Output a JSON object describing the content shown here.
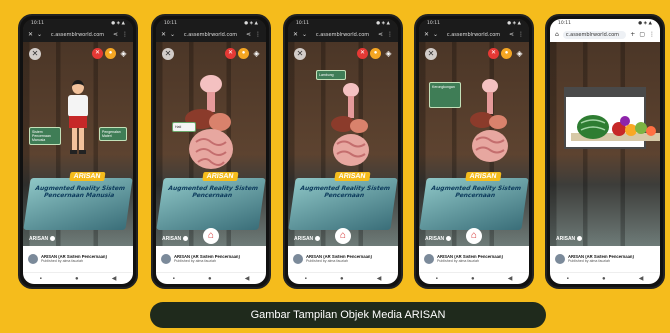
{
  "phones": [
    {
      "status_time": "10:11",
      "status_icons": "● ◈ ▲",
      "url": "c.assemblrworld.com",
      "scene_label": "ARISAN",
      "book_brand": "ARISAN",
      "book_title": "Augmented Reality Sistem Pencernaan Manusia",
      "tags": [
        "Sistem Pencernaan Manusia",
        "Pengenalan Materi"
      ],
      "footer_title": "ARISAN (AR Sistem Pencernaan)",
      "footer_sub": "Published by alma fauziah",
      "theme": "dark",
      "content": "student"
    },
    {
      "status_time": "10:11",
      "status_icons": "● ◈ ▲",
      "url": "c.assemblrworld.com",
      "scene_label": "ARISAN",
      "book_brand": "ARISAN",
      "book_title": "Augmented Reality Sistem Pencernaan",
      "tags": [
        "Hati"
      ],
      "footer_title": "ARISAN (AR Sistem Pencernaan)",
      "footer_sub": "Published by alma fauziah",
      "theme": "dark",
      "content": "organ"
    },
    {
      "status_time": "10:11",
      "status_icons": "● ◈ ▲",
      "url": "c.assemblrworld.com",
      "scene_label": "ARISAN",
      "book_brand": "ARISAN",
      "book_title": "Augmented Reality Sistem Pencernaan",
      "tags": [
        "Lambung"
      ],
      "footer_title": "ARISAN (AR Sistem Pencernaan)",
      "footer_sub": "Published by alma fauziah",
      "theme": "dark",
      "content": "organ"
    },
    {
      "status_time": "10:11",
      "status_icons": "● ◈ ▲",
      "url": "c.assemblrworld.com",
      "scene_label": "ARISAN",
      "book_brand": "ARISAN",
      "book_title": "Augmented Reality Sistem Pencernaan",
      "tags": [
        "Kerongkongan"
      ],
      "footer_title": "ARISAN (AR Sistem Pencernaan)",
      "footer_sub": "Published by alma fauziah",
      "theme": "dark",
      "content": "organ"
    },
    {
      "status_time": "10:11",
      "status_icons": "● ◈ ▲",
      "url": "c.assemblrworld.com",
      "scene_label": "ARISAN",
      "book_brand": "",
      "book_title": "",
      "tags": [],
      "footer_title": "ARISAN (AR Sistem Pencernaan)",
      "footer_sub": "Published by alma fauziah",
      "theme": "light",
      "content": "card"
    }
  ],
  "caption": "Gambar Tampilan Objek Media ARISAN",
  "icons": {
    "close": "close-icon",
    "home": "home-icon",
    "share": "share-icon",
    "menu": "more-vert-icon",
    "back": "back-icon"
  },
  "colors": {
    "background": "#f5bc1c",
    "caption_bg": "#1f2a1c",
    "accent_red": "#e53935",
    "accent_orange": "#f5a623"
  }
}
